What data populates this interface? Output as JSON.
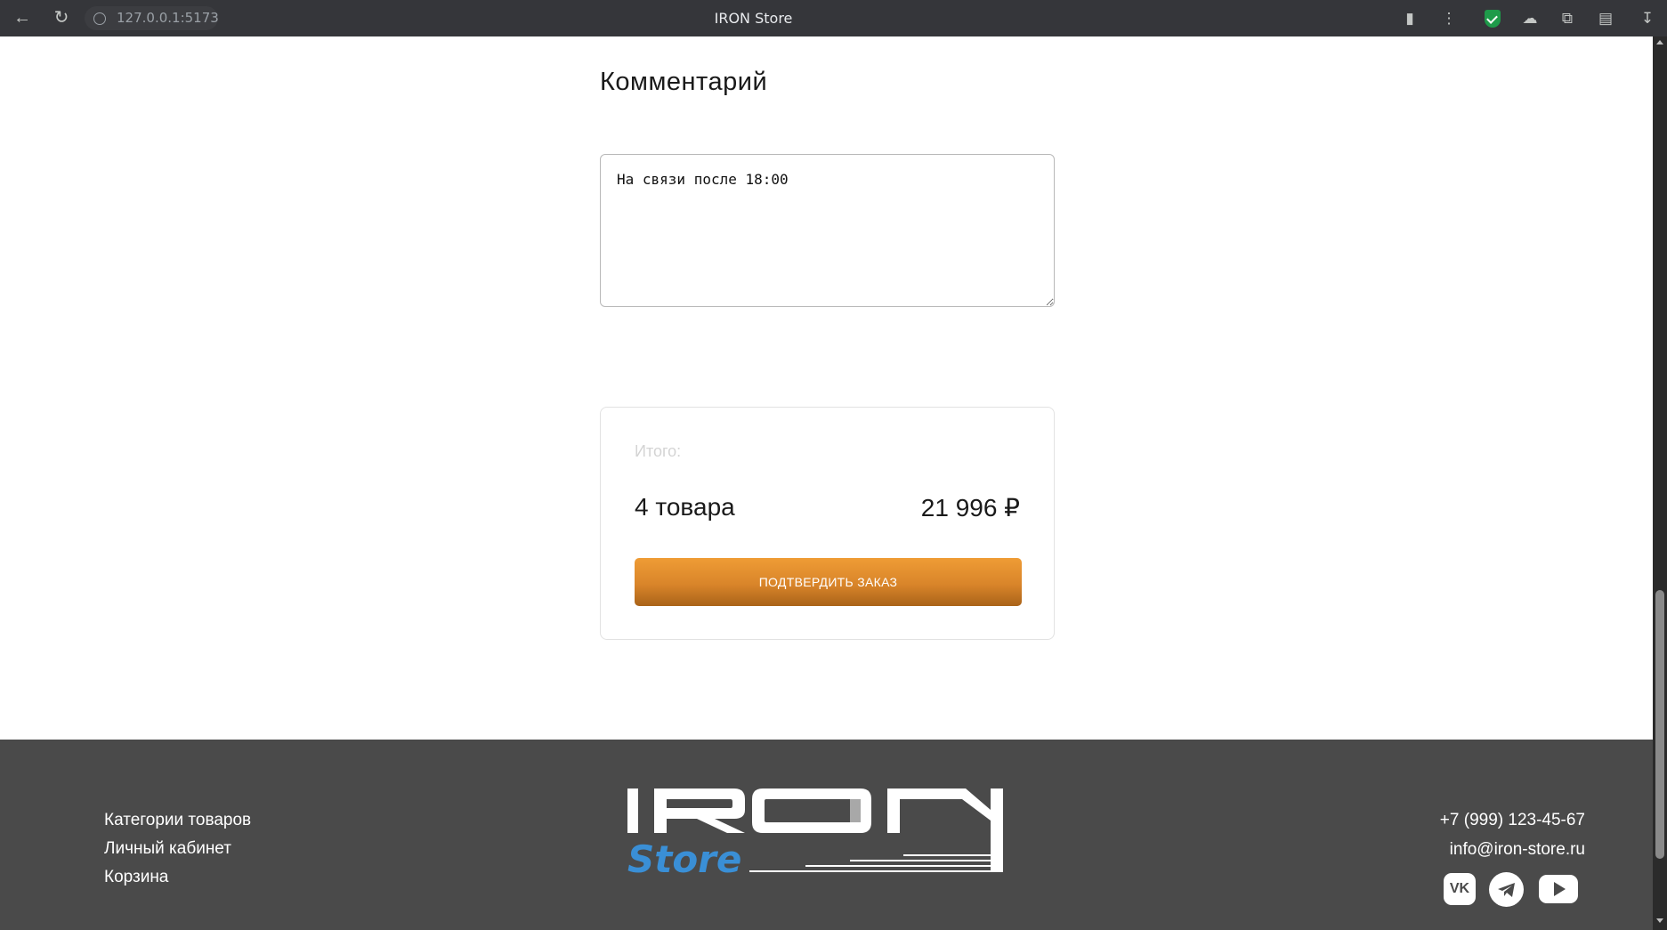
{
  "browser": {
    "url": "127.0.0.1:5173",
    "tab_title": "IRON Store"
  },
  "comment": {
    "heading": "Комментарий",
    "value": "На связи после 18:00"
  },
  "summary": {
    "total_label": "Итого:",
    "items_count": "4 товара",
    "total_sum": "21 996 ₽",
    "confirm_label": "ПОДТВЕРДИТЬ ЗАКАЗ"
  },
  "footer": {
    "links": [
      "Категории товаров",
      "Личный кабинет",
      "Корзина"
    ],
    "logo_word": "IRON",
    "logo_sub": "Store",
    "phone": "+7 (999) 123-45-67",
    "email": "info@iron-store.ru",
    "social": [
      "vk-icon",
      "telegram-icon",
      "youtube-icon"
    ],
    "logo_accent_color": "#3a8fd6",
    "button_color": "#e08a2d",
    "footer_bg": "#4a4a4a"
  }
}
